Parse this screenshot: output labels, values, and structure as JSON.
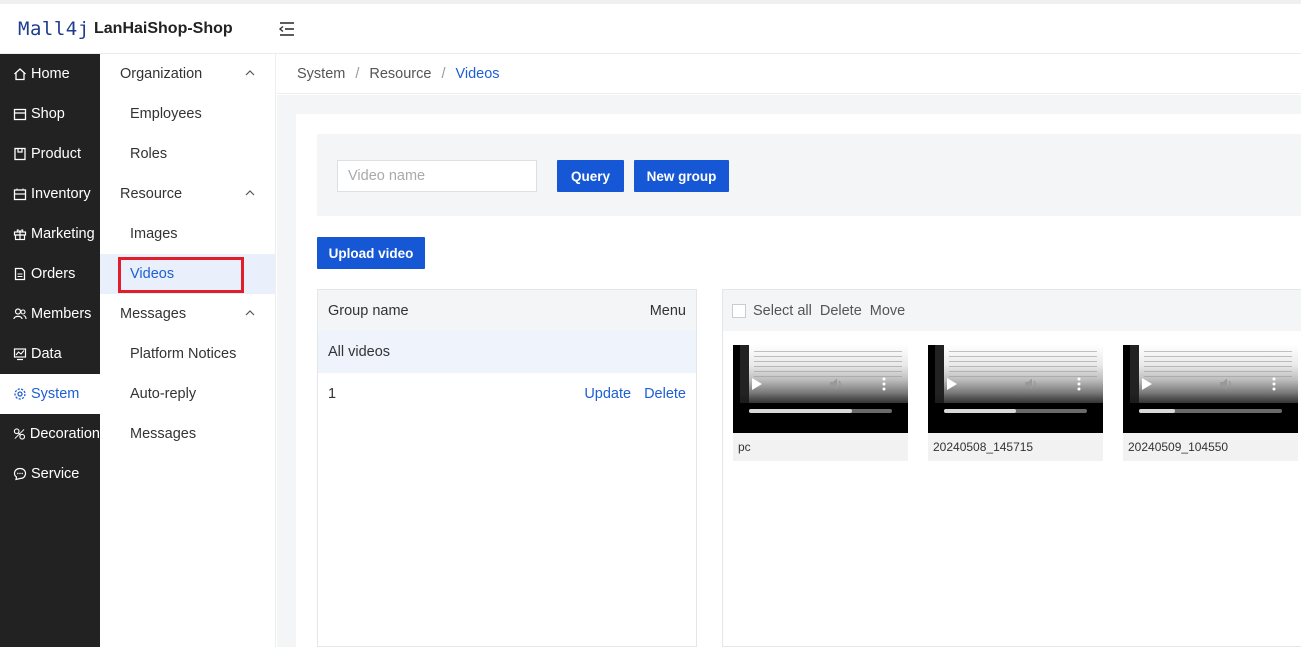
{
  "header": {
    "logo_text": "Mall4j",
    "shop_name": "LanHaiShop-Shop"
  },
  "main_nav": [
    {
      "label": "Home",
      "icon": "home-icon"
    },
    {
      "label": "Shop",
      "icon": "shop-icon"
    },
    {
      "label": "Product",
      "icon": "product-icon"
    },
    {
      "label": "Inventory",
      "icon": "inventory-icon"
    },
    {
      "label": "Marketing",
      "icon": "gift-icon"
    },
    {
      "label": "Orders",
      "icon": "orders-icon"
    },
    {
      "label": "Members",
      "icon": "members-icon"
    },
    {
      "label": "Data",
      "icon": "data-icon"
    },
    {
      "label": "System",
      "icon": "gear-icon",
      "active": true
    },
    {
      "label": "Decoration",
      "icon": "decoration-icon"
    },
    {
      "label": "Service",
      "icon": "chat-icon"
    }
  ],
  "sub_nav": {
    "organization": {
      "label": "Organization",
      "items": [
        "Employees",
        "Roles"
      ]
    },
    "resource": {
      "label": "Resource",
      "items": [
        "Images",
        "Videos"
      ]
    },
    "messages": {
      "label": "Messages",
      "items": [
        "Platform Notices",
        "Auto-reply",
        "Messages"
      ]
    },
    "active_item": "Videos"
  },
  "breadcrumb": {
    "items": [
      "System",
      "Resource",
      "Videos"
    ],
    "separator": "/"
  },
  "search": {
    "placeholder": "Video name",
    "value": "",
    "query_label": "Query",
    "new_group_label": "New group"
  },
  "upload_label": "Upload video",
  "groups": {
    "header_name": "Group name",
    "header_menu": "Menu",
    "all_label": "All videos",
    "rows": [
      {
        "name": "1",
        "update_label": "Update",
        "delete_label": "Delete"
      }
    ]
  },
  "videos": {
    "toolbar": {
      "select_all": "Select all",
      "delete": "Delete",
      "move": "Move"
    },
    "items": [
      {
        "name": "pc",
        "progress": 0.72
      },
      {
        "name": "20240508_145715",
        "progress": 0.5
      },
      {
        "name": "20240509_104550",
        "progress": 0.25
      }
    ]
  },
  "colors": {
    "accent": "#1557d4",
    "sidebar_bg": "#222222",
    "highlight_red": "#e21d2a"
  }
}
